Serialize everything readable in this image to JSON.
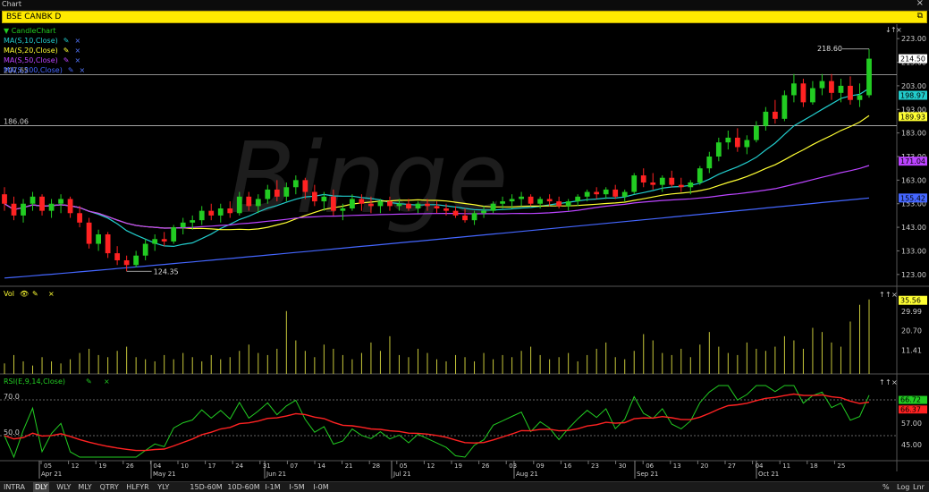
{
  "window": {
    "title": "Chart",
    "close_glyph": "×"
  },
  "symbol_bar": {
    "symbol": "BSE CANBK D",
    "detach_glyph": "⧉"
  },
  "price_pane": {
    "legend": [
      {
        "label": "CandleChart",
        "color": "#22cc22",
        "prefix": "▼"
      },
      {
        "label": "MA(S,10,Close)",
        "color": "#22cccc"
      },
      {
        "label": "MA(S,20,Close)",
        "color": "#ffff33"
      },
      {
        "label": "MA(S,50,Close)",
        "color": "#bb44ff"
      },
      {
        "label": "MA(S,200,Close)",
        "color": "#4466ff"
      }
    ],
    "y_ticks": [
      "223.00",
      "213.00",
      "203.00",
      "193.00",
      "183.00",
      "173.00",
      "163.00",
      "153.00",
      "143.00",
      "133.00",
      "123.00"
    ],
    "hlines": [
      {
        "label": "207.65",
        "value": 207.65
      },
      {
        "label": "186.06",
        "value": 186.06
      }
    ],
    "price_tags": [
      {
        "label": "214.50",
        "value": 214.5,
        "bg": "#ffffff",
        "fg": "#000000"
      },
      {
        "label": "198.97",
        "value": 198.97,
        "bg": "#22cccc",
        "fg": "#000000"
      },
      {
        "label": "189.93",
        "value": 189.93,
        "bg": "#ffff33",
        "fg": "#000000"
      },
      {
        "label": "171.04",
        "value": 171.04,
        "bg": "#bb44ff",
        "fg": "#000000"
      },
      {
        "label": "155.42",
        "value": 155.42,
        "bg": "#4466ff",
        "fg": "#000000"
      }
    ],
    "annotations": [
      {
        "label": "218.60",
        "value": 218.6
      },
      {
        "label": "124.35",
        "value": 124.35
      }
    ],
    "watermark": "Binge",
    "buttons": [
      "↓",
      "↑",
      "×"
    ]
  },
  "volume_pane": {
    "title": "Vol",
    "y_ticks": [
      "29.99",
      "20.70",
      "11.41"
    ],
    "tag": {
      "label": "35.56",
      "bg": "#ffff33"
    },
    "buttons": [
      "↑",
      "↑",
      "×"
    ]
  },
  "rsi_pane": {
    "title": "RSI(E,9,14,Close)",
    "y_ticks": [
      "57.00",
      "45.00"
    ],
    "left_levels": [
      "70.0",
      "50.0"
    ],
    "tags": [
      {
        "label": "66.72",
        "bg": "#22cc22"
      },
      {
        "label": "66.37",
        "bg": "#ff2222"
      }
    ],
    "buttons": [
      "↑",
      "↑",
      "×"
    ]
  },
  "x_axis": {
    "labels": [
      "05",
      "12",
      "19",
      "26",
      "04",
      "10",
      "17",
      "24",
      "31",
      "07",
      "14",
      "21",
      "28",
      "05",
      "12",
      "19",
      "26",
      "03",
      "09",
      "16",
      "23",
      "30",
      "06",
      "13",
      "20",
      "27",
      "04",
      "11",
      "18",
      "25"
    ],
    "months": [
      "Apr 21",
      "May 21",
      "Jun 21",
      "Jul 21",
      "Aug 21",
      "Sep 21",
      "Oct 21"
    ]
  },
  "periodicity": [
    "INTRA",
    "DLY",
    "WLY",
    "MLY",
    "QTRY",
    "HLFYR",
    "YLY"
  ],
  "active_period": "DLY",
  "ranges": [
    "15D-60M",
    "10D-60M",
    "I-1M",
    "I-5M",
    "I-0M"
  ],
  "scale_buttons": [
    "%",
    "Log",
    "Lnr"
  ],
  "colors": {
    "up": "#22cc22",
    "down": "#ff2222",
    "background": "#000000",
    "accent": "#ffea00"
  },
  "chart_data": {
    "type": "candlestick",
    "title": "BSE CANBK D",
    "ylim": [
      118,
      228
    ],
    "last": {
      "price": 214.5,
      "ma10": 198.97,
      "ma20": 189.93,
      "ma50": 171.04,
      "ma200": 155.42,
      "volume": 35.56,
      "rsi": 66.72,
      "rsi_signal": 66.37
    },
    "high": 218.6,
    "low": 124.35,
    "candles": [
      [
        157,
        160,
        150,
        153
      ],
      [
        153,
        156,
        146,
        148
      ],
      [
        148,
        155,
        145,
        153
      ],
      [
        153,
        158,
        150,
        156
      ],
      [
        156,
        157,
        148,
        150
      ],
      [
        150,
        155,
        147,
        153
      ],
      [
        153,
        157,
        149,
        155
      ],
      [
        155,
        156,
        147,
        149
      ],
      [
        149,
        152,
        143,
        145
      ],
      [
        145,
        147,
        134,
        136
      ],
      [
        136,
        142,
        133,
        140
      ],
      [
        140,
        141,
        130,
        132
      ],
      [
        132,
        135,
        127,
        129
      ],
      [
        129,
        131,
        124.35,
        127
      ],
      [
        127,
        133,
        126,
        131
      ],
      [
        131,
        138,
        129,
        136
      ],
      [
        136,
        140,
        133,
        138
      ],
      [
        138,
        141,
        135,
        137
      ],
      [
        137,
        144,
        136,
        143
      ],
      [
        143,
        147,
        140,
        145
      ],
      [
        145,
        148,
        142,
        146
      ],
      [
        146,
        152,
        144,
        150
      ],
      [
        150,
        153,
        146,
        148
      ],
      [
        148,
        153,
        145,
        151
      ],
      [
        151,
        154,
        147,
        149
      ],
      [
        149,
        158,
        148,
        156
      ],
      [
        156,
        158,
        150,
        152
      ],
      [
        152,
        157,
        149,
        155
      ],
      [
        155,
        161,
        153,
        159
      ],
      [
        159,
        163,
        154,
        156
      ],
      [
        156,
        162,
        154,
        160
      ],
      [
        160,
        165,
        157,
        163
      ],
      [
        163,
        164,
        155,
        158
      ],
      [
        158,
        161,
        152,
        154
      ],
      [
        154,
        158,
        150,
        156
      ],
      [
        156,
        159,
        148,
        150
      ],
      [
        150,
        153,
        146,
        151
      ],
      [
        151,
        157,
        150,
        155
      ],
      [
        155,
        157,
        150,
        153
      ],
      [
        153,
        156,
        149,
        152
      ],
      [
        152,
        155,
        149,
        154
      ],
      [
        154,
        156,
        150,
        152
      ],
      [
        152,
        155,
        150,
        153
      ],
      [
        153,
        155,
        150,
        151
      ],
      [
        151,
        154,
        149,
        153
      ],
      [
        153,
        155,
        150,
        152
      ],
      [
        152,
        154,
        149,
        151
      ],
      [
        151,
        153,
        148,
        150
      ],
      [
        150,
        152,
        147,
        148
      ],
      [
        148,
        151,
        145,
        146
      ],
      [
        146,
        150,
        144,
        149
      ],
      [
        149,
        152,
        147,
        150
      ],
      [
        150,
        154,
        149,
        153
      ],
      [
        153,
        156,
        151,
        154
      ],
      [
        154,
        157,
        151,
        155
      ],
      [
        155,
        158,
        152,
        156
      ],
      [
        156,
        157,
        152,
        153
      ],
      [
        153,
        156,
        151,
        155
      ],
      [
        155,
        157,
        152,
        154
      ],
      [
        154,
        156,
        151,
        152
      ],
      [
        152,
        155,
        150,
        154
      ],
      [
        154,
        157,
        152,
        156
      ],
      [
        156,
        159,
        154,
        158
      ],
      [
        158,
        160,
        155,
        157
      ],
      [
        157,
        160,
        155,
        159
      ],
      [
        159,
        161,
        155,
        156
      ],
      [
        156,
        159,
        154,
        158
      ],
      [
        158,
        166,
        157,
        165
      ],
      [
        165,
        168,
        160,
        162
      ],
      [
        162,
        166,
        159,
        161
      ],
      [
        161,
        165,
        158,
        164
      ],
      [
        164,
        167,
        160,
        161
      ],
      [
        161,
        164,
        158,
        160
      ],
      [
        160,
        163,
        157,
        162
      ],
      [
        162,
        169,
        161,
        168
      ],
      [
        168,
        175,
        166,
        173
      ],
      [
        173,
        181,
        171,
        179
      ],
      [
        179,
        184,
        176,
        181
      ],
      [
        181,
        185,
        175,
        177
      ],
      [
        177,
        182,
        174,
        180
      ],
      [
        180,
        188,
        179,
        186
      ],
      [
        186,
        194,
        184,
        192
      ],
      [
        192,
        197,
        187,
        189
      ],
      [
        189,
        201,
        188,
        199
      ],
      [
        199,
        208,
        196,
        204
      ],
      [
        204,
        206,
        194,
        196
      ],
      [
        196,
        205,
        195,
        202
      ],
      [
        202,
        208,
        199,
        205
      ],
      [
        205,
        208,
        197,
        200
      ],
      [
        200,
        206,
        196,
        203
      ],
      [
        203,
        207,
        195,
        197
      ],
      [
        197,
        204,
        194,
        199
      ],
      [
        199,
        218.6,
        198,
        214.5
      ]
    ],
    "volume": [
      5,
      9,
      6,
      4,
      8,
      6,
      5,
      7,
      10,
      12,
      9,
      8,
      11,
      13,
      8,
      7,
      6,
      9,
      7,
      10,
      8,
      6,
      9,
      7,
      8,
      11,
      14,
      10,
      9,
      12,
      30,
      16,
      11,
      8,
      14,
      12,
      9,
      7,
      10,
      15,
      11,
      18,
      9,
      8,
      12,
      10,
      7,
      6,
      9,
      8,
      6,
      10,
      7,
      9,
      8,
      11,
      13,
      9,
      7,
      8,
      10,
      6,
      9,
      12,
      15,
      8,
      7,
      11,
      19,
      16,
      10,
      9,
      12,
      8,
      14,
      20,
      13,
      10,
      9,
      15,
      12,
      11,
      13,
      18,
      16,
      12,
      22,
      20,
      15,
      13,
      25,
      33,
      35.56
    ]
  }
}
